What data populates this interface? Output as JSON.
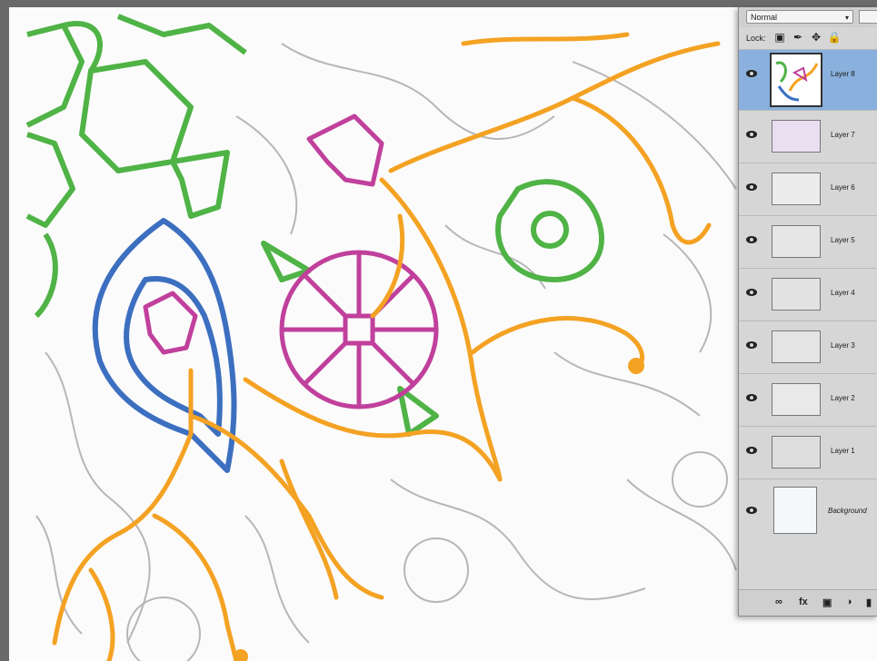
{
  "layers_panel": {
    "blend_mode": "Normal",
    "lock_label": "Lock:",
    "lock_icons": [
      "lock-pixels-icon",
      "brush-icon",
      "move-icon",
      "lock-icon"
    ],
    "layers": [
      {
        "name": "Layer 8",
        "selected": true,
        "visible": true
      },
      {
        "name": "Layer 7",
        "selected": false,
        "visible": true
      },
      {
        "name": "Layer 6",
        "selected": false,
        "visible": true
      },
      {
        "name": "Layer 5",
        "selected": false,
        "visible": true
      },
      {
        "name": "Layer 4",
        "selected": false,
        "visible": true
      },
      {
        "name": "Layer 3",
        "selected": false,
        "visible": true
      },
      {
        "name": "Layer 2",
        "selected": false,
        "visible": true
      },
      {
        "name": "Layer 1",
        "selected": false,
        "visible": true
      },
      {
        "name": "Background",
        "selected": false,
        "visible": true
      }
    ],
    "footer_icons": [
      "link-icon",
      "fx-icon",
      "mask-icon",
      "adjustment-icon",
      "group-icon"
    ]
  },
  "colors": {
    "green": "#4fb346",
    "orange": "#f4a223",
    "magenta": "#c0409c",
    "blue": "#3c6fc0",
    "selection": "#8ab1dd"
  }
}
